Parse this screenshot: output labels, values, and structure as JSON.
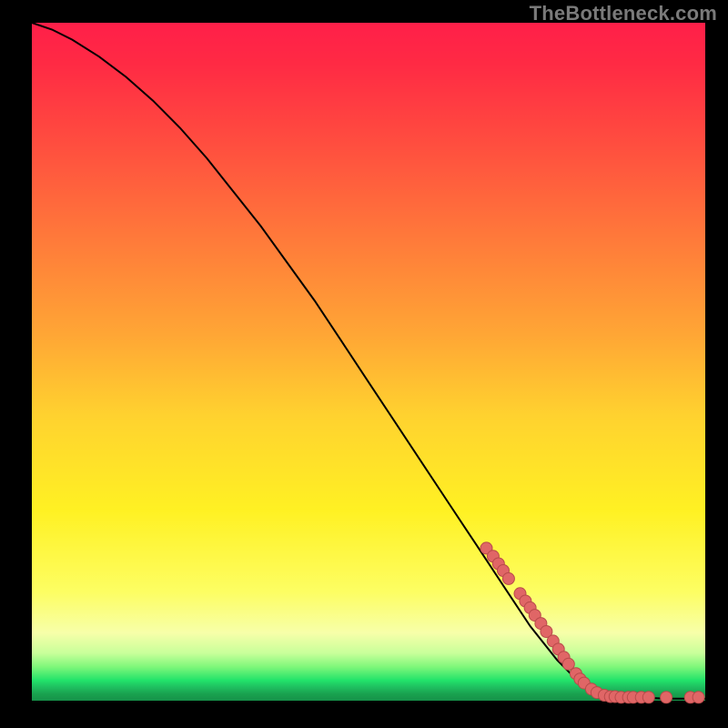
{
  "watermark": "TheBottleneck.com",
  "colors": {
    "dot_fill": "#e06666",
    "dot_stroke": "#b84a4a",
    "line": "#000000",
    "background_black": "#000000"
  },
  "chart_data": {
    "type": "line",
    "title": "",
    "xlabel": "",
    "ylabel": "",
    "xlim": [
      0,
      100
    ],
    "ylim": [
      0,
      100
    ],
    "series": [
      {
        "name": "curve",
        "x": [
          0,
          3,
          6,
          10,
          14,
          18,
          22,
          26,
          30,
          34,
          38,
          42,
          46,
          50,
          54,
          58,
          62,
          66,
          70,
          74,
          78,
          80,
          82,
          84,
          86,
          88,
          90,
          92,
          94,
          96,
          98,
          100
        ],
        "y": [
          100,
          99,
          97.5,
          95,
          92,
          88.5,
          84.5,
          80,
          75,
          70,
          64.5,
          59,
          53,
          47,
          41,
          35,
          29,
          23,
          17,
          11,
          6,
          4,
          2.5,
          1.5,
          1,
          0.7,
          0.5,
          0.4,
          0.3,
          0.3,
          0.3,
          0.3
        ]
      }
    ],
    "scatter_points": [
      {
        "x": 67.5,
        "y": 22.5
      },
      {
        "x": 68.5,
        "y": 21.3
      },
      {
        "x": 69.3,
        "y": 20.2
      },
      {
        "x": 70.0,
        "y": 19.2
      },
      {
        "x": 70.8,
        "y": 18.0
      },
      {
        "x": 72.5,
        "y": 15.8
      },
      {
        "x": 73.3,
        "y": 14.7
      },
      {
        "x": 74.0,
        "y": 13.7
      },
      {
        "x": 74.7,
        "y": 12.6
      },
      {
        "x": 75.6,
        "y": 11.4
      },
      {
        "x": 76.4,
        "y": 10.2
      },
      {
        "x": 77.4,
        "y": 8.8
      },
      {
        "x": 78.2,
        "y": 7.6
      },
      {
        "x": 79.0,
        "y": 6.4
      },
      {
        "x": 79.7,
        "y": 5.4
      },
      {
        "x": 80.8,
        "y": 4.0
      },
      {
        "x": 81.4,
        "y": 3.2
      },
      {
        "x": 82.0,
        "y": 2.6
      },
      {
        "x": 83.1,
        "y": 1.7
      },
      {
        "x": 83.9,
        "y": 1.2
      },
      {
        "x": 85.0,
        "y": 0.8
      },
      {
        "x": 85.9,
        "y": 0.6
      },
      {
        "x": 86.6,
        "y": 0.6
      },
      {
        "x": 87.5,
        "y": 0.5
      },
      {
        "x": 88.6,
        "y": 0.5
      },
      {
        "x": 89.3,
        "y": 0.5
      },
      {
        "x": 90.5,
        "y": 0.5
      },
      {
        "x": 91.6,
        "y": 0.5
      },
      {
        "x": 94.2,
        "y": 0.5
      },
      {
        "x": 97.8,
        "y": 0.5
      },
      {
        "x": 99.0,
        "y": 0.5
      }
    ]
  }
}
